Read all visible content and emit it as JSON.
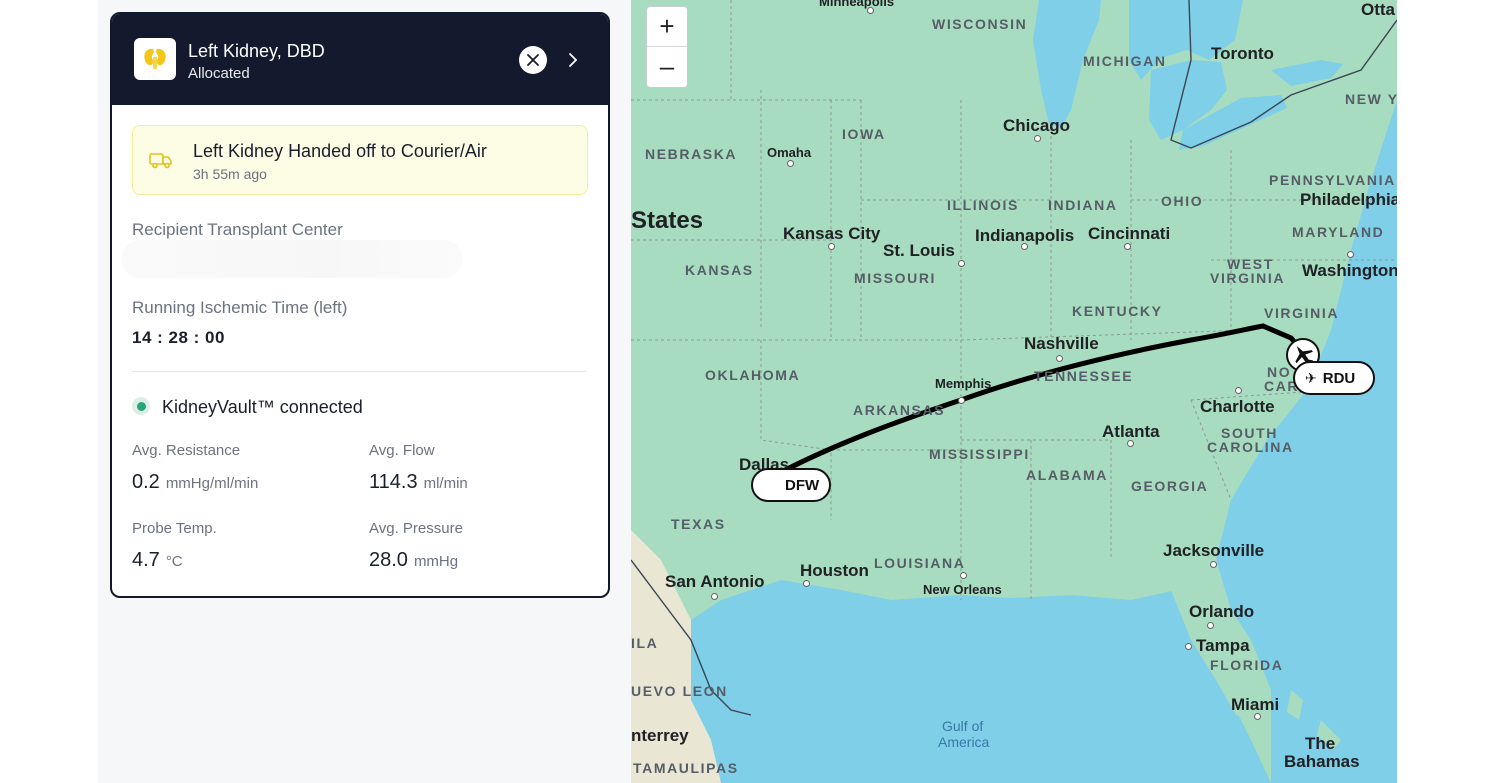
{
  "organ_card": {
    "title": "Left Kidney, DBD",
    "status": "Allocated",
    "organ_icon": "kidney-icon",
    "alert": {
      "title": "Left Kidney Handed off to Courier/Air",
      "time": "3h 55m ago",
      "icon": "truck-icon"
    },
    "recipient_label": "Recipient Transplant Center",
    "ischemic_label": "Running Ischemic Time (left)",
    "ischemic_time": "14 : 28 : 00",
    "connection": "KidneyVault™ connected",
    "metrics": [
      {
        "label": "Avg. Resistance",
        "value": "0.2",
        "unit": "mmHg/ml/min"
      },
      {
        "label": "Avg. Flow",
        "value": "114.3",
        "unit": "ml/min"
      },
      {
        "label": "Probe Temp.",
        "value": "4.7",
        "unit": "°C"
      },
      {
        "label": "Avg. Pressure",
        "value": "28.0",
        "unit": "mmHg"
      }
    ]
  },
  "map": {
    "zoom_in": "+",
    "zoom_out": "–",
    "origin_code": "DFW",
    "destination_code": "RDU",
    "labels": {
      "minneapolis": "Minneapolis",
      "wisconsin": "WISCONSIN",
      "michigan": "MICHIGAN",
      "toronto": "Toronto",
      "ottawa": "Otta",
      "new_york": "NEW YO",
      "iowa": "IOWA",
      "chicago": "Chicago",
      "nebraska": "NEBRASKA",
      "omaha": "Omaha",
      "pennsylvania": "PENNSYLVANIA",
      "philadelphia": "Philadelphia",
      "states": "States",
      "illinois": "ILLINOIS",
      "indiana": "INDIANA",
      "ohio": "OHIO",
      "maryland": "MARYLAND",
      "kansas_city": "Kansas City",
      "st_louis": "St. Louis",
      "indianapolis": "Indianapolis",
      "cincinnati": "Cincinnati",
      "west_virginia_1": "WEST",
      "west_virginia_2": "VIRGINIA",
      "washington": "Washington",
      "kansas": "KANSAS",
      "missouri": "MISSOURI",
      "kentucky": "KENTUCKY",
      "virginia": "VIRGINIA",
      "oklahoma": "OKLAHOMA",
      "nashville": "Nashville",
      "tennessee": "TENNESSEE",
      "memphis": "Memphis",
      "north_carolina_1": "NO",
      "north_carolina_2": "CARO",
      "arkansas": "ARKANSAS",
      "charlotte": "Charlotte",
      "atlanta": "Atlanta",
      "south_carolina_1": "SOUTH",
      "south_carolina_2": "CAROLINA",
      "dallas": "Dallas",
      "mississippi": "MISSISSIPPI",
      "alabama": "ALABAMA",
      "georgia": "GEORGIA",
      "texas": "TEXAS",
      "jacksonville": "Jacksonville",
      "louisiana": "LOUISIANA",
      "san_antonio": "San Antonio",
      "houston": "Houston",
      "new_orleans": "New Orleans",
      "orlando": "Orlando",
      "tampa": "Tampa",
      "florida": "FLORIDA",
      "coahuila": "ILA",
      "nuevo_leon": "UEVO LEON",
      "miami": "Miami",
      "gulf_1": "Gulf of",
      "gulf_2": "America",
      "monterrey": "nterrey",
      "bahamas_1": "The",
      "bahamas_2": "Bahamas",
      "tamaulipas": "TAMAULIPAS"
    }
  },
  "colors": {
    "header_bg": "#141a2e",
    "alert_bg": "#fdfde6",
    "alert_border": "#f1f09a",
    "connected_green": "#2aa37a",
    "land": "#a8dcc0",
    "water": "#7fcfe8",
    "route": "#000000"
  }
}
